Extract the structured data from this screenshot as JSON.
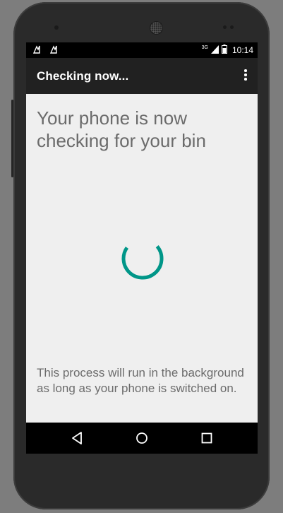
{
  "status_bar": {
    "network_type": "3G",
    "time": "10:14",
    "left_icons": [
      "notification-icon",
      "notification-icon"
    ]
  },
  "app_bar": {
    "title": "Checking now...",
    "overflow_icon": "more-vert-icon"
  },
  "main": {
    "headline": "Your phone is now checking for your bin",
    "footer": "This process will run in the background as long as your phone is switched on."
  },
  "nav_bar": {
    "icons": [
      "back-icon",
      "home-icon",
      "recents-icon"
    ]
  },
  "colors": {
    "accent": "#009688",
    "app_bar": "#212121",
    "background": "#efefef",
    "text": "#6b6b6b"
  }
}
